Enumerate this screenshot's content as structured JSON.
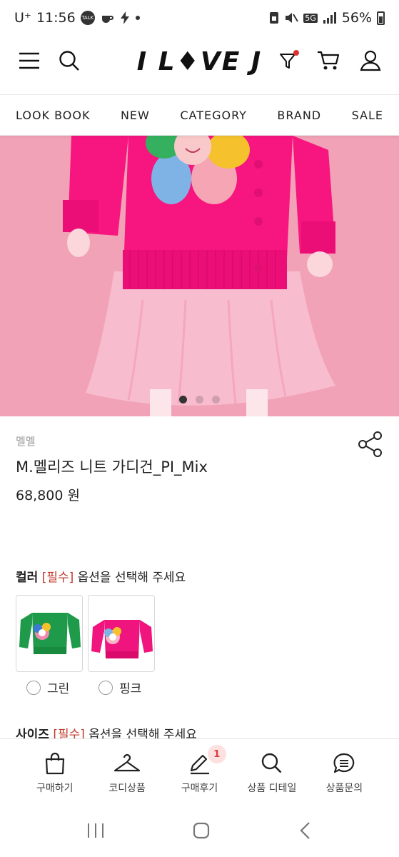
{
  "status_bar": {
    "carrier": "U⁺",
    "time": "11:56",
    "talk_badge": "TALK",
    "network": "5G",
    "battery": "56%"
  },
  "header": {
    "logo": "I L♦VE J",
    "icons": [
      "menu-icon",
      "search-icon",
      "filter-icon",
      "cart-icon",
      "user-icon"
    ],
    "filter_dot_color": "#e03030"
  },
  "nav": {
    "items": [
      "LOOK BOOK",
      "NEW",
      "CATEGORY",
      "BRAND",
      "SALE"
    ]
  },
  "carousel": {
    "slide_count": 3,
    "active_index": 0
  },
  "product": {
    "brand": "멜멜",
    "name": "M.멜리즈 니트 가디건_PI_Mix",
    "price": "68,800 원"
  },
  "options": {
    "color": {
      "label": "컬러",
      "required": "[필수]",
      "hint": "옵션을 선택해 주세요",
      "choices": [
        {
          "label": "그린",
          "color": "#1e9a4a"
        },
        {
          "label": "핑크",
          "color": "#f0147e"
        }
      ]
    },
    "size": {
      "label": "사이즈",
      "required": "[필수]",
      "hint": "옵션을 선택해 주세요"
    }
  },
  "tabbar": {
    "items": [
      {
        "label": "구매하기",
        "icon": "shopping-bag-icon"
      },
      {
        "label": "코디상품",
        "icon": "hanger-icon"
      },
      {
        "label": "구매후기",
        "icon": "pencil-icon",
        "badge": "1"
      },
      {
        "label": "상품 디테일",
        "icon": "magnifier-icon"
      },
      {
        "label": "상품문의",
        "icon": "chat-bubble-icon"
      }
    ]
  },
  "system_nav": [
    "recent-apps-icon",
    "home-icon",
    "back-icon"
  ]
}
